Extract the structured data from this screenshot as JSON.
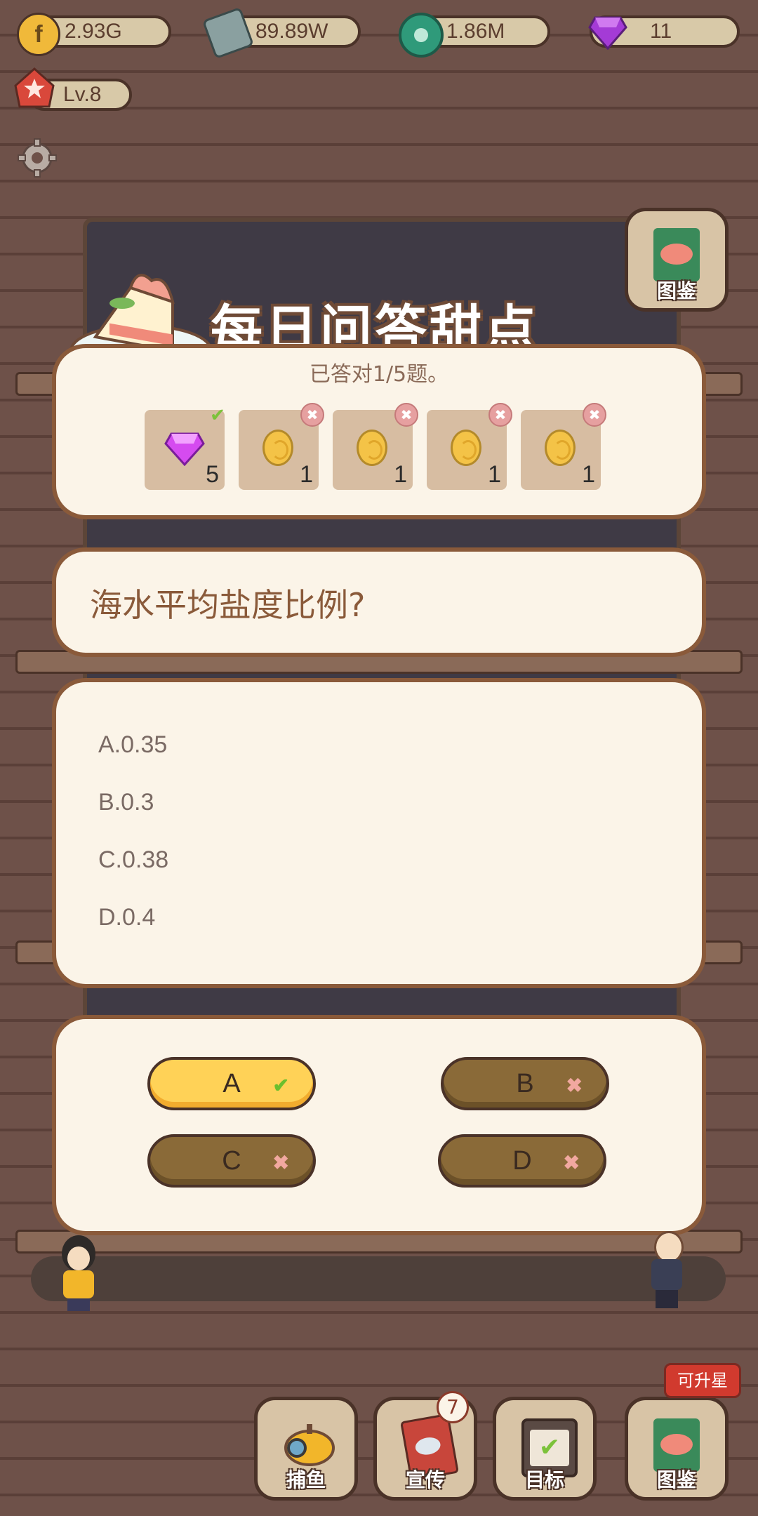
{
  "resources": [
    {
      "icon": "coin-f-icon",
      "value": "2.93G"
    },
    {
      "icon": "cash-stack-icon",
      "value": "89.89W"
    },
    {
      "icon": "green-gem-icon",
      "value": "1.86M"
    },
    {
      "icon": "purple-gem-icon",
      "value": "11"
    }
  ],
  "level": "Lv.8",
  "collection_label": "图鉴",
  "quiz": {
    "title": "每日问答甜点",
    "progress_text": "已答对1/5题。",
    "rewards": [
      {
        "type": "gem",
        "amount": "5",
        "status": "correct"
      },
      {
        "type": "coin",
        "amount": "1",
        "status": "wrong"
      },
      {
        "type": "coin",
        "amount": "1",
        "status": "wrong"
      },
      {
        "type": "coin",
        "amount": "1",
        "status": "wrong"
      },
      {
        "type": "coin",
        "amount": "1",
        "status": "wrong"
      }
    ],
    "question": "海水平均盐度比例?",
    "options": [
      "A.0.35",
      "B.0.3",
      "C.0.38",
      "D.0.4"
    ],
    "answers": [
      {
        "label": "A",
        "status": "correct"
      },
      {
        "label": "B",
        "status": "wrong"
      },
      {
        "label": "C",
        "status": "wrong"
      },
      {
        "label": "D",
        "status": "wrong"
      }
    ]
  },
  "bottom_nav": [
    {
      "label": "捕鱼",
      "icon": "submarine-icon"
    },
    {
      "label": "宣传",
      "icon": "flyer-icon",
      "badge": "7"
    },
    {
      "label": "目标",
      "icon": "clipboard-check-icon"
    },
    {
      "label": "图鉴",
      "icon": "fish-book-icon",
      "tag": "可升星"
    }
  ]
}
